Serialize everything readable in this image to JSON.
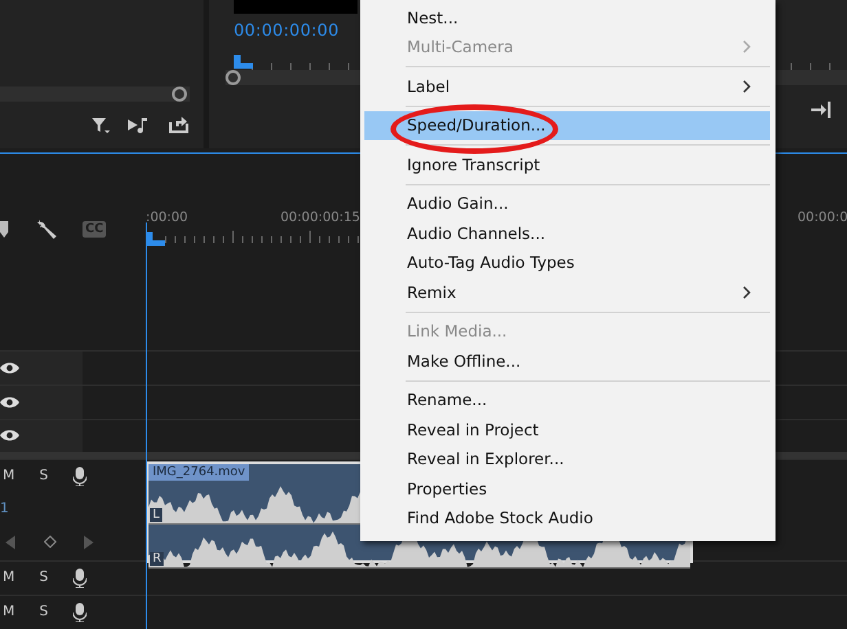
{
  "source_panel": {
    "zoom_slider": {
      "level": 1
    }
  },
  "program_monitor": {
    "timecode": "00:00:00:00",
    "zoom_slider": {
      "level": 0
    }
  },
  "timeline": {
    "captions_label": "CC",
    "ruler_labels": [
      ":00:00",
      "00:00:00:15",
      "00:00:0"
    ],
    "video_tracks": [
      {
        "visible": true
      },
      {
        "visible": true
      },
      {
        "visible": true
      }
    ],
    "audio_tracks": [
      {
        "mute": "M",
        "solo": "S",
        "number": "1",
        "expanded": true,
        "clip": {
          "name": "IMG_2764.mov",
          "channels": [
            "L",
            "R"
          ]
        }
      },
      {
        "mute": "M",
        "solo": "S",
        "expanded": false
      },
      {
        "mute": "M",
        "solo": "S",
        "expanded": false
      }
    ]
  },
  "context_menu": {
    "items": [
      {
        "kind": "item",
        "label": "Nest...",
        "disabled": false,
        "submenu": false,
        "selected": false
      },
      {
        "kind": "item",
        "label": "Multi-Camera",
        "disabled": true,
        "submenu": true,
        "selected": false
      },
      {
        "kind": "separator"
      },
      {
        "kind": "item",
        "label": "Label",
        "disabled": false,
        "submenu": true,
        "selected": false
      },
      {
        "kind": "separator"
      },
      {
        "kind": "item",
        "label": "Speed/Duration...",
        "disabled": false,
        "submenu": false,
        "selected": true
      },
      {
        "kind": "separator"
      },
      {
        "kind": "item",
        "label": "Ignore Transcript",
        "disabled": false,
        "submenu": false,
        "selected": false
      },
      {
        "kind": "separator"
      },
      {
        "kind": "item",
        "label": "Audio Gain...",
        "disabled": false,
        "submenu": false,
        "selected": false
      },
      {
        "kind": "item",
        "label": "Audio Channels...",
        "disabled": false,
        "submenu": false,
        "selected": false
      },
      {
        "kind": "item",
        "label": "Auto-Tag Audio Types",
        "disabled": false,
        "submenu": false,
        "selected": false
      },
      {
        "kind": "item",
        "label": "Remix",
        "disabled": false,
        "submenu": true,
        "selected": false
      },
      {
        "kind": "separator"
      },
      {
        "kind": "item",
        "label": "Link Media...",
        "disabled": true,
        "submenu": false,
        "selected": false
      },
      {
        "kind": "item",
        "label": "Make Offline...",
        "disabled": false,
        "submenu": false,
        "selected": false
      },
      {
        "kind": "separator"
      },
      {
        "kind": "item",
        "label": "Rename...",
        "disabled": false,
        "submenu": false,
        "selected": false
      },
      {
        "kind": "item",
        "label": "Reveal in Project",
        "disabled": false,
        "submenu": false,
        "selected": false
      },
      {
        "kind": "item",
        "label": "Reveal in Explorer...",
        "disabled": false,
        "submenu": false,
        "selected": false
      },
      {
        "kind": "item",
        "label": "Properties",
        "disabled": false,
        "submenu": false,
        "selected": false
      },
      {
        "kind": "item",
        "label": "Find Adobe Stock Audio",
        "disabled": false,
        "submenu": false,
        "selected": false
      }
    ]
  }
}
